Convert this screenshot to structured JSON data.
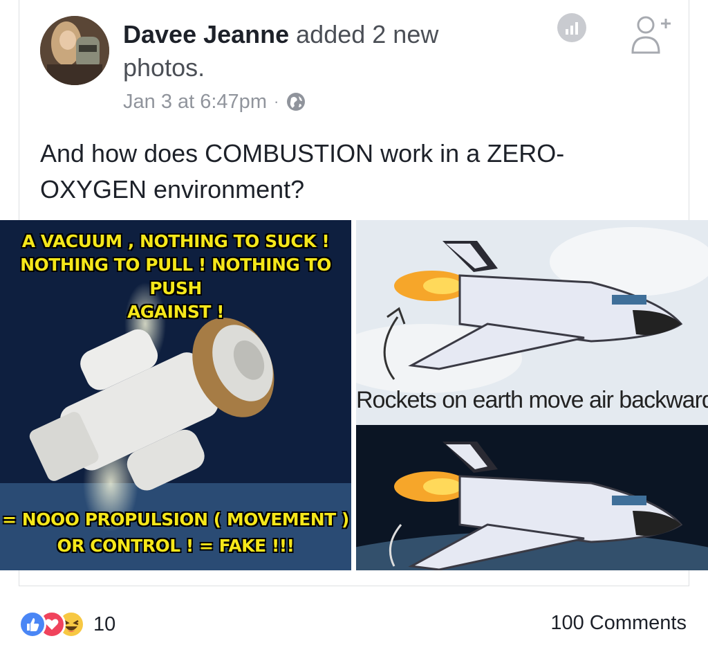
{
  "post": {
    "author": "Davee Jeanne",
    "action": " added 2 new photos.",
    "timestamp": "Jan 3 at 6:47pm",
    "separator": "·",
    "privacy_icon": "globe-icon",
    "text": "And how does COMBUSTION work in a ZERO-OXYGEN environment?"
  },
  "header_icons": {
    "insights": "insights-icon",
    "add_friend": "add-friend-icon"
  },
  "photos": {
    "left": {
      "top_text_1": "A VACUUM , NOTHING TO SUCK !",
      "top_text_2": "NOTHING TO PULL ! NOTHING TO PUSH",
      "top_text_3": "AGAINST !",
      "bottom_text_1": "= NOOO PROPULSION ( MOVEMENT )",
      "bottom_text_2": "OR CONTROL ! = FAKE !!!"
    },
    "right": {
      "caption": "Rockets on earth move air backwards"
    }
  },
  "footer": {
    "reaction_count": "10",
    "comments": "100 Comments",
    "reaction_colors": {
      "like": "#4a86f5",
      "love": "#f0435c",
      "haha": "#f7c843"
    }
  }
}
